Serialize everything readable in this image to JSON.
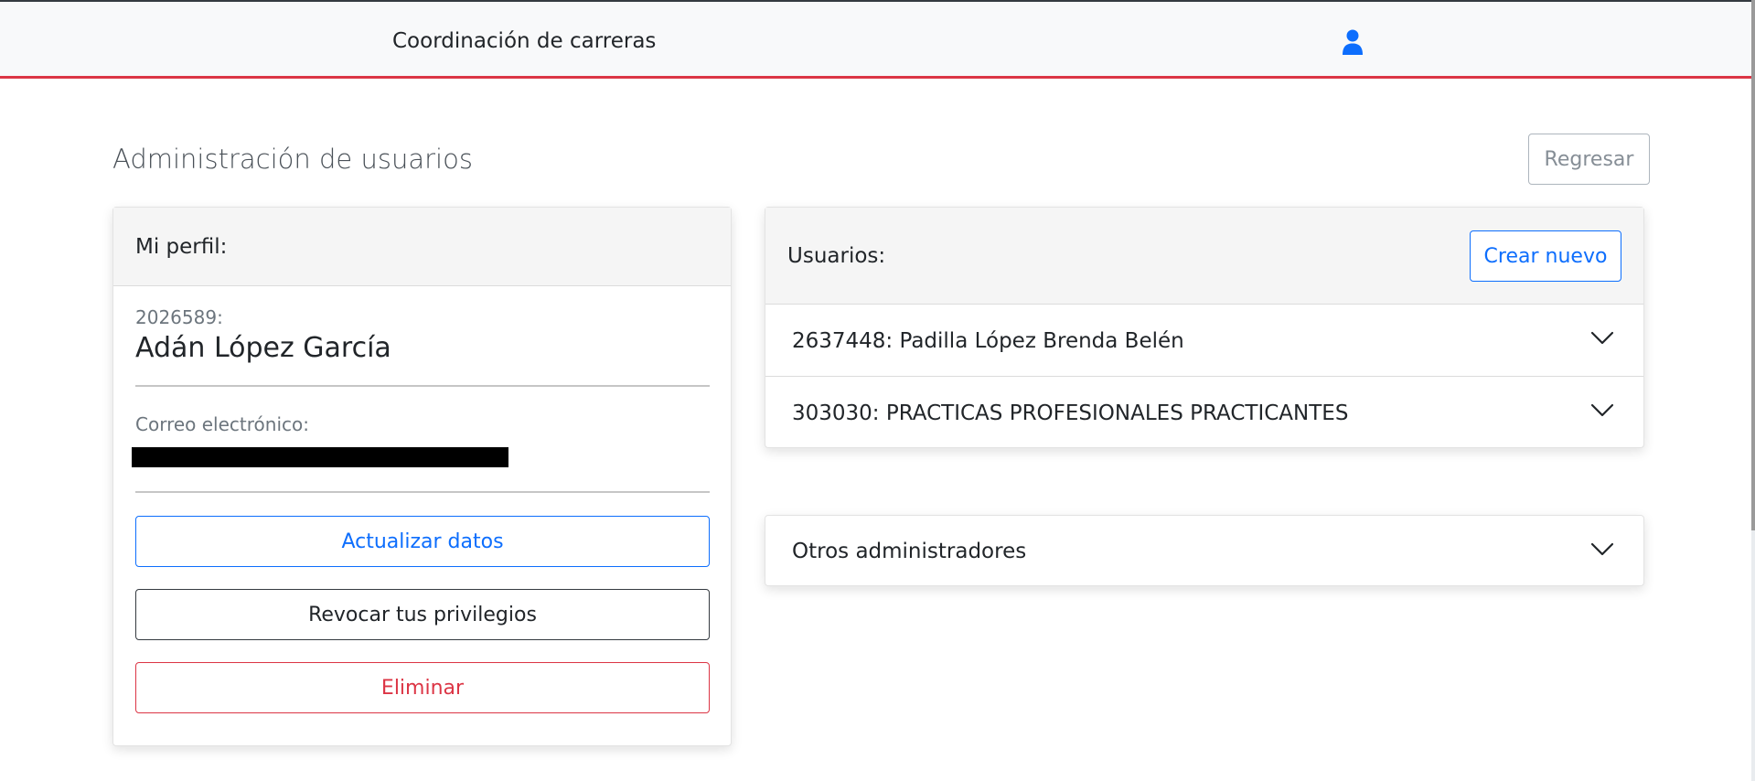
{
  "navbar": {
    "brand": "Coordinación de carreras",
    "user_icon": "user-icon",
    "accent_color": "#dc3545"
  },
  "page": {
    "title": "Administración de usuarios",
    "back_label": "Regresar"
  },
  "profile": {
    "header": "Mi perfil:",
    "id": "2026589:",
    "name": "Adán López García",
    "email_label": "Correo electrónico:",
    "update_label": "Actualizar datos",
    "revoke_label": "Revocar tus privilegios",
    "delete_label": "Eliminar"
  },
  "users": {
    "header": "Usuarios:",
    "create_label": "Crear nuevo",
    "items": [
      {
        "label": "2637448: Padilla López Brenda Belén",
        "icon": "chevron-down-icon"
      },
      {
        "label": "303030: PRACTICAS PROFESIONALES PRACTICANTES",
        "icon": "chevron-down-icon"
      }
    ]
  },
  "admins": {
    "label": "Otros administradores",
    "icon": "chevron-down-icon"
  }
}
